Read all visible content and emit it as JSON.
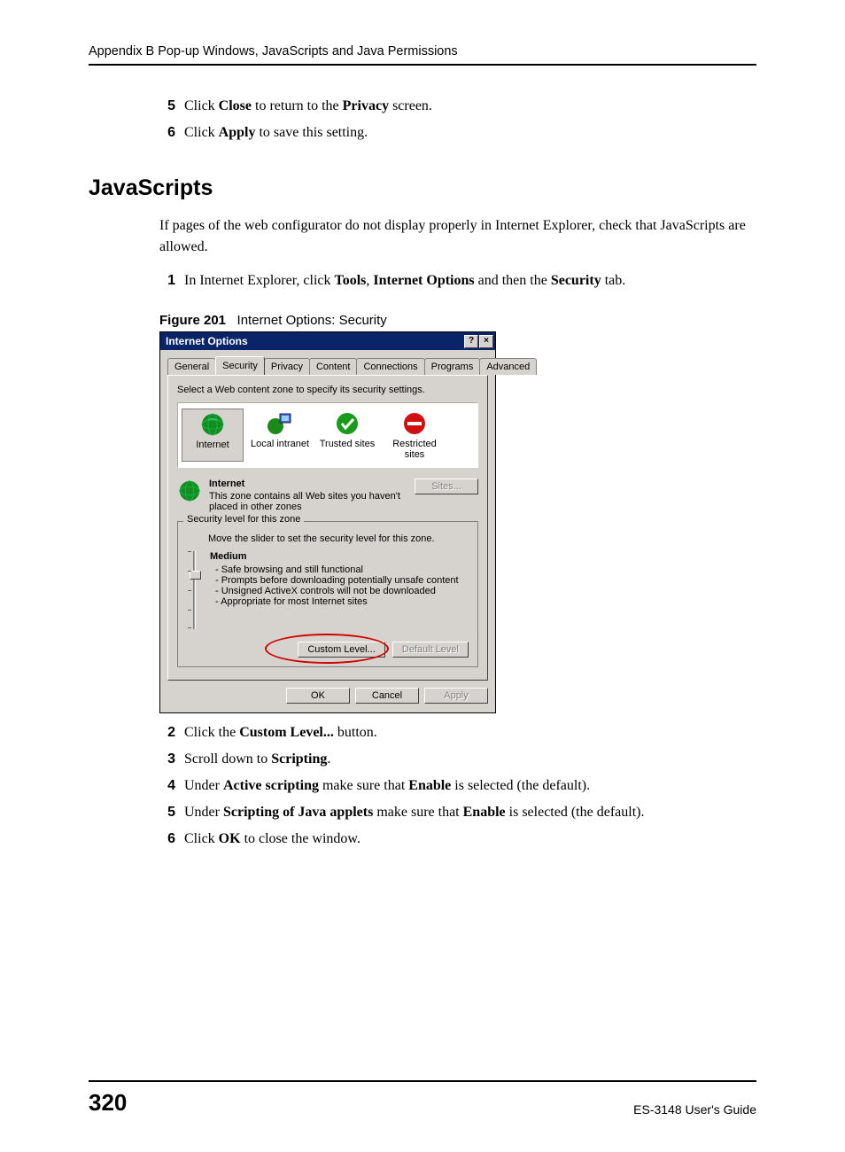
{
  "header": "Appendix B Pop-up Windows, JavaScripts and Java Permissions",
  "top_steps": [
    {
      "num": "5",
      "pre": "Click ",
      "b1": "Close",
      "mid": " to return to the ",
      "b2": "Privacy",
      "post": " screen."
    },
    {
      "num": "6",
      "pre": "Click ",
      "b1": "Apply",
      "mid": " to save this setting.",
      "b2": "",
      "post": ""
    }
  ],
  "section_heading": "JavaScripts",
  "intro": "If pages of the web configurator do not display properly in Internet Explorer, check that JavaScripts are allowed.",
  "step1": {
    "num": "1",
    "pre": "In Internet Explorer, click ",
    "b1": "Tools",
    "c1": ", ",
    "b2": "Internet Options",
    "c2": " and then the ",
    "b3": "Security",
    "post": " tab."
  },
  "figure": {
    "label": "Figure 201",
    "caption": "Internet Options: Security"
  },
  "dialog": {
    "title": "Internet Options",
    "help_glyph": "?",
    "close_glyph": "×",
    "tabs": [
      "General",
      "Security",
      "Privacy",
      "Content",
      "Connections",
      "Programs",
      "Advanced"
    ],
    "active_tab_index": 1,
    "zone_instruction": "Select a Web content zone to specify its security settings.",
    "zones": [
      "Internet",
      "Local intranet",
      "Trusted sites",
      "Restricted sites"
    ],
    "selected_zone_index": 0,
    "zone_detail": {
      "title": "Internet",
      "desc": "This zone contains all Web sites you haven't placed in other zones",
      "sites_btn": "Sites..."
    },
    "groupbox_legend": "Security level for this zone",
    "slider_hint": "Move the slider to set the security level for this zone.",
    "level_name": "Medium",
    "level_bullets": [
      "- Safe browsing and still functional",
      "- Prompts before downloading potentially unsafe content",
      "- Unsigned ActiveX controls will not be downloaded",
      "- Appropriate for most Internet sites"
    ],
    "custom_level_btn": "Custom Level...",
    "default_level_btn": "Default Level",
    "ok_btn": "OK",
    "cancel_btn": "Cancel",
    "apply_btn": "Apply"
  },
  "bottom_steps": [
    {
      "num": "2",
      "parts": [
        "Click the ",
        "Custom Level...",
        " button."
      ]
    },
    {
      "num": "3",
      "parts": [
        "Scroll down to ",
        "Scripting",
        "."
      ]
    },
    {
      "num": "4",
      "parts": [
        "Under ",
        "Active scripting",
        " make sure that ",
        "Enable",
        " is selected (the default)."
      ]
    },
    {
      "num": "5",
      "parts": [
        "Under ",
        "Scripting of Java applets",
        " make sure that ",
        "Enable",
        " is selected (the default)."
      ]
    },
    {
      "num": "6",
      "parts": [
        "Click ",
        "OK",
        " to close the window."
      ]
    }
  ],
  "footer": {
    "page_number": "320",
    "guide": "ES-3148 User's Guide"
  }
}
